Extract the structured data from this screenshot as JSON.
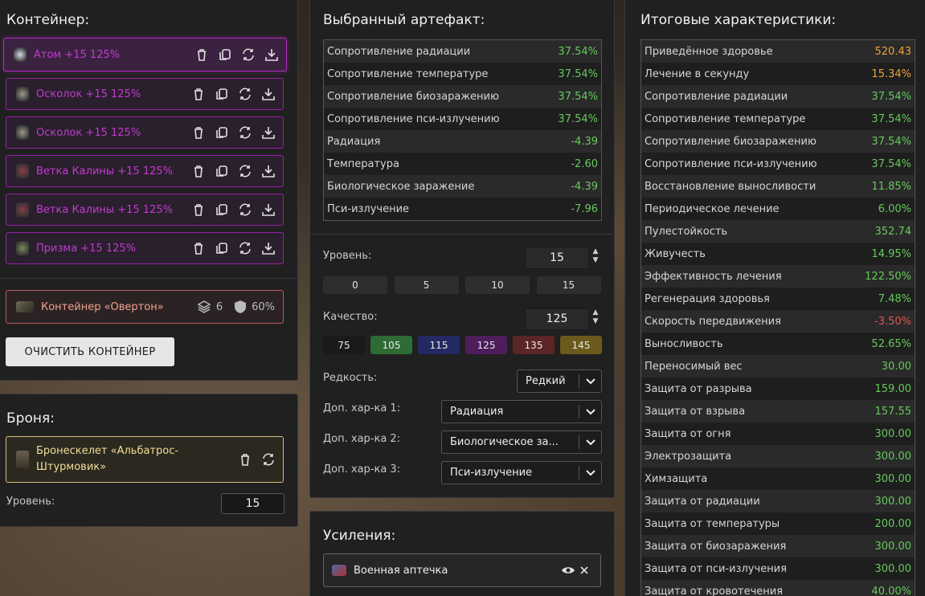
{
  "container": {
    "title": "Контейнер:",
    "artifacts": [
      {
        "name": "Атом +15 125%",
        "icon": "atom-artifact-icon",
        "active": true
      },
      {
        "name": "Осколок +15 125%",
        "icon": "shard-artifact-icon"
      },
      {
        "name": "Осколок +15 125%",
        "icon": "shard-artifact-icon"
      },
      {
        "name": "Ветка Калины +15 125%",
        "icon": "viburnum-branch-icon"
      },
      {
        "name": "Ветка Калины +15 125%",
        "icon": "viburnum-branch-icon"
      },
      {
        "name": "Призма +15 125%",
        "icon": "prism-artifact-icon"
      }
    ],
    "container_item": {
      "name": "Контейнер «Овертон»",
      "slots": "6",
      "protection": "60%"
    },
    "clear_label": "ОЧИСТИТЬ КОНТЕЙНЕР"
  },
  "armor": {
    "title": "Броня:",
    "name": "Бронескелет «Альбатрос-Штурмовик»",
    "level_label": "Уровень:",
    "level_value": "15"
  },
  "selected": {
    "title": "Выбранный артефакт:",
    "stats": [
      {
        "label": "Сопротивление радиации",
        "value": "37.54%",
        "color": "#67c95c"
      },
      {
        "label": "Сопротивление температуре",
        "value": "37.54%",
        "color": "#67c95c"
      },
      {
        "label": "Сопротивление биозаражению",
        "value": "37.54%",
        "color": "#67c95c"
      },
      {
        "label": "Сопротивление пси-излучению",
        "value": "37.54%",
        "color": "#67c95c"
      },
      {
        "label": "Радиация",
        "value": "-4.39",
        "color": "#67c95c"
      },
      {
        "label": "Температура",
        "value": "-2.60",
        "color": "#67c95c"
      },
      {
        "label": "Биологическое заражение",
        "value": "-4.39",
        "color": "#67c95c"
      },
      {
        "label": "Пси-излучение",
        "value": "-7.96",
        "color": "#67c95c"
      }
    ],
    "level_label": "Уровень:",
    "level_value": "15",
    "level_presets": [
      "0",
      "5",
      "10",
      "15"
    ],
    "quality_label": "Качество:",
    "quality_value": "125",
    "quality_presets": [
      {
        "label": "75",
        "color": "#1a1a1a"
      },
      {
        "label": "105",
        "color": "#2e6b35"
      },
      {
        "label": "115",
        "color": "#232a63"
      },
      {
        "label": "125",
        "color": "#4e1d5c"
      },
      {
        "label": "135",
        "color": "#5c2526"
      },
      {
        "label": "145",
        "color": "#6b5a1b"
      }
    ],
    "rarity_label": "Редкость:",
    "rarity_value": "Редкий",
    "extra1_label": "Доп. хар-ка 1:",
    "extra1_value": "Радиация",
    "extra2_label": "Доп. хар-ка 2:",
    "extra2_value": "Биологическое за...",
    "extra3_label": "Доп. хар-ка 3:",
    "extra3_value": "Пси-излучение"
  },
  "boosts": {
    "title": "Усиления:",
    "item": "Военная аптечка"
  },
  "totals": {
    "title": "Итоговые характеристики:",
    "stats": [
      {
        "label": "Приведённое здоровье",
        "value": "520.43",
        "color": "#e9a43a"
      },
      {
        "label": "Лечение в секунду",
        "value": "15.34%",
        "color": "#e9a43a"
      },
      {
        "label": "Сопротивление радиации",
        "value": "37.54%",
        "color": "#67c95c"
      },
      {
        "label": "Сопротивление температуре",
        "value": "37.54%",
        "color": "#67c95c"
      },
      {
        "label": "Сопротивление биозаражению",
        "value": "37.54%",
        "color": "#67c95c"
      },
      {
        "label": "Сопротивление пси-излучению",
        "value": "37.54%",
        "color": "#67c95c"
      },
      {
        "label": "Восстановление выносливости",
        "value": "11.85%",
        "color": "#67c95c"
      },
      {
        "label": "Периодическое лечение",
        "value": "6.00%",
        "color": "#67c95c"
      },
      {
        "label": "Пулестойкость",
        "value": "352.74",
        "color": "#67c95c"
      },
      {
        "label": "Живучесть",
        "value": "14.95%",
        "color": "#67c95c"
      },
      {
        "label": "Эффективность лечения",
        "value": "122.50%",
        "color": "#67c95c"
      },
      {
        "label": "Регенерация здоровья",
        "value": "7.48%",
        "color": "#67c95c"
      },
      {
        "label": "Скорость передвижения",
        "value": "-3.50%",
        "color": "#e05555"
      },
      {
        "label": "Выносливость",
        "value": "52.65%",
        "color": "#67c95c"
      },
      {
        "label": "Переносимый вес",
        "value": "30.00",
        "color": "#67c95c"
      },
      {
        "label": "Защита от разрыва",
        "value": "159.00",
        "color": "#67c95c"
      },
      {
        "label": "Защита от взрыва",
        "value": "157.55",
        "color": "#67c95c"
      },
      {
        "label": "Защита от огня",
        "value": "300.00",
        "color": "#67c95c"
      },
      {
        "label": "Электрозащита",
        "value": "300.00",
        "color": "#67c95c"
      },
      {
        "label": "Химзащита",
        "value": "300.00",
        "color": "#67c95c"
      },
      {
        "label": "Защита от радиации",
        "value": "300.00",
        "color": "#67c95c"
      },
      {
        "label": "Защита от температуры",
        "value": "200.00",
        "color": "#67c95c"
      },
      {
        "label": "Защита от биозаражения",
        "value": "300.00",
        "color": "#67c95c"
      },
      {
        "label": "Защита от пси-излучения",
        "value": "300.00",
        "color": "#67c95c"
      },
      {
        "label": "Защита от кровотечения",
        "value": "40.00%",
        "color": "#67c95c"
      }
    ]
  }
}
